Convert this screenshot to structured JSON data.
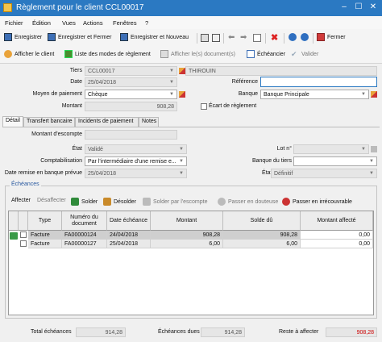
{
  "window": {
    "title": "Règlement pour le client CCL00017",
    "minimize": "–",
    "maximize": "☐",
    "close": "✕"
  },
  "menu": [
    "Fichier",
    "Édition",
    "Vues",
    "Actions",
    "Fenêtres",
    "?"
  ],
  "toolbar": {
    "enregistrer": "Enregistrer",
    "enregistrer_fermer": "Enregistrer et Fermer",
    "enregistrer_nouveau": "Enregistrer et Nouveau",
    "fermer": "Fermer"
  },
  "toolbar2": {
    "afficher_client": "Afficher le client",
    "liste_modes": "Liste des modes de règlement",
    "afficher_documents": "Afficher le(s) document(s)",
    "echeancier": "Échéancier",
    "valider": "Valider"
  },
  "header": {
    "tiers_label": "Tiers",
    "tiers_code": "CCL00017",
    "tiers_name": "THIROUIN",
    "date_label": "Date",
    "date": "25/04/2018",
    "reference_label": "Référence",
    "reference": "",
    "moyen_label": "Moyen de paiement",
    "moyen": "Chèque",
    "banque_label": "Banque",
    "banque": "Banque Principale",
    "montant_label": "Montant",
    "montant": "908,28",
    "ecart_label": "Écart de règlement"
  },
  "tabs": [
    "Détail",
    "Transfert bancaire",
    "Incidents de paiement",
    "Notes"
  ],
  "detail": {
    "montant_escompte_label": "Montant d'escompte",
    "montant_escompte": "",
    "etat_label": "État",
    "etat": "Validé",
    "lot_label": "Lot n°",
    "lot": "",
    "compta_label": "Comptabilisation",
    "compta": "Par l'intermédiaire d'une remise e...",
    "banque_tiers_label": "Banque du tiers",
    "banque_tiers": "",
    "date_remise_label": "Date remise en banque prévue",
    "date_remise": "25/04/2018",
    "etat_impaye_label": "État impayé",
    "etat_impaye": "Définitif"
  },
  "echeances": {
    "group_title": "Échéances",
    "actions": {
      "affecter": "Affecter",
      "desaffecter": "Désaffecter",
      "solder": "Solder",
      "desolder": "Désolder",
      "solder_escompte": "Solder par l'escompte",
      "passer_douteuse": "Passer en douteuse",
      "passer_irrecouvrable": "Passer en irrécouvrable"
    },
    "columns": [
      "Type",
      "Numéro du document",
      "Date échéance",
      "Montant",
      "Solde dû",
      "Montant affecté"
    ],
    "rows": [
      {
        "type": "Facture",
        "numero": "FA00000124",
        "date": "24/04/2018",
        "montant": "908,28",
        "solde": "908,28",
        "affecte": "0,00"
      },
      {
        "type": "Facture",
        "numero": "FA00000127",
        "date": "25/04/2018",
        "montant": "6,00",
        "solde": "6,00",
        "affecte": "0,00"
      }
    ]
  },
  "footer": {
    "total_label": "Total échéances",
    "total": "914,28",
    "dues_label": "Échéances dues",
    "dues": "914,28",
    "reste_label": "Reste à affecter",
    "reste": "908,28"
  },
  "colors": {
    "title_bar": "#2b79c2",
    "accent_text": "#2a5aa0",
    "negative": "#cc0000"
  }
}
